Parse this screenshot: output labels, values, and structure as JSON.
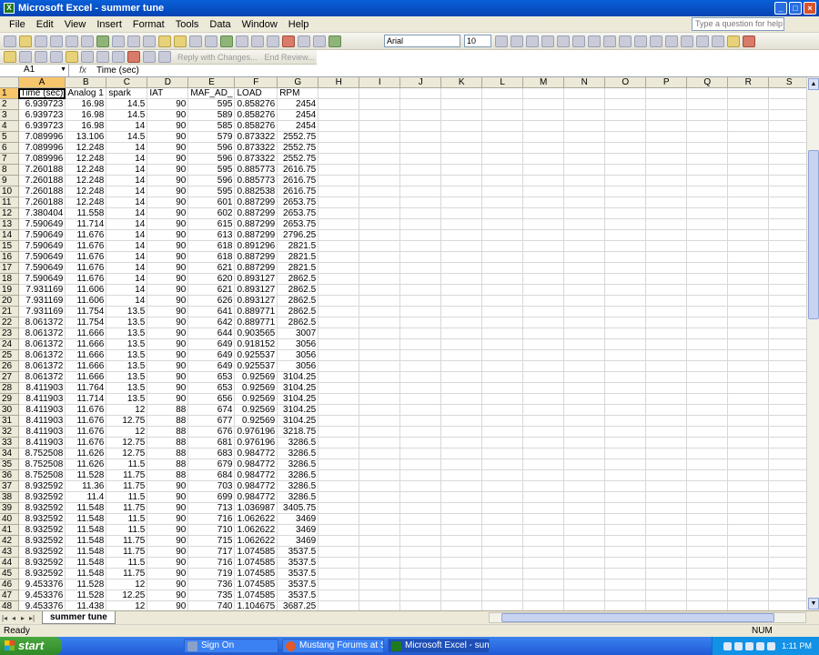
{
  "window": {
    "title": "Microsoft Excel - summer tune"
  },
  "menu": [
    "File",
    "Edit",
    "View",
    "Insert",
    "Format",
    "Tools",
    "Data",
    "Window",
    "Help"
  ],
  "help_placeholder": "Type a question for help",
  "formatting": {
    "font": "Arial",
    "size": "10"
  },
  "review_toolbar": {
    "reply_label": "Reply with Changes...",
    "end_label": "End Review..."
  },
  "formula_bar": {
    "cell_ref": "A1",
    "fx": "fx",
    "content": "Time (sec)"
  },
  "columns": [
    "A",
    "B",
    "C",
    "D",
    "E",
    "F",
    "G",
    "H",
    "I",
    "J",
    "K",
    "L",
    "M",
    "N",
    "O",
    "P",
    "Q",
    "R",
    "S"
  ],
  "headers": [
    "Time (sec)",
    "Analog 1",
    "spark",
    "IAT",
    "MAF_AD_",
    "LOAD",
    "RPM"
  ],
  "rows": [
    [
      "6.939723",
      "16.98",
      "14.5",
      "90",
      "595",
      "0.858276",
      "2454"
    ],
    [
      "6.939723",
      "16.98",
      "14.5",
      "90",
      "589",
      "0.858276",
      "2454"
    ],
    [
      "6.939723",
      "16.98",
      "14",
      "90",
      "585",
      "0.858276",
      "2454"
    ],
    [
      "7.089996",
      "13.106",
      "14.5",
      "90",
      "579",
      "0.873322",
      "2552.75"
    ],
    [
      "7.089996",
      "12.248",
      "14",
      "90",
      "596",
      "0.873322",
      "2552.75"
    ],
    [
      "7.089996",
      "12.248",
      "14",
      "90",
      "596",
      "0.873322",
      "2552.75"
    ],
    [
      "7.260188",
      "12.248",
      "14",
      "90",
      "595",
      "0.885773",
      "2616.75"
    ],
    [
      "7.260188",
      "12.248",
      "14",
      "90",
      "596",
      "0.885773",
      "2616.75"
    ],
    [
      "7.260188",
      "12.248",
      "14",
      "90",
      "595",
      "0.882538",
      "2616.75"
    ],
    [
      "7.260188",
      "12.248",
      "14",
      "90",
      "601",
      "0.887299",
      "2653.75"
    ],
    [
      "7.380404",
      "11.558",
      "14",
      "90",
      "602",
      "0.887299",
      "2653.75"
    ],
    [
      "7.590649",
      "11.714",
      "14",
      "90",
      "615",
      "0.887299",
      "2653.75"
    ],
    [
      "7.590649",
      "11.676",
      "14",
      "90",
      "613",
      "0.887299",
      "2796.25"
    ],
    [
      "7.590649",
      "11.676",
      "14",
      "90",
      "618",
      "0.891296",
      "2821.5"
    ],
    [
      "7.590649",
      "11.676",
      "14",
      "90",
      "618",
      "0.887299",
      "2821.5"
    ],
    [
      "7.590649",
      "11.676",
      "14",
      "90",
      "621",
      "0.887299",
      "2821.5"
    ],
    [
      "7.590649",
      "11.676",
      "14",
      "90",
      "620",
      "0.893127",
      "2862.5"
    ],
    [
      "7.931169",
      "11.606",
      "14",
      "90",
      "621",
      "0.893127",
      "2862.5"
    ],
    [
      "7.931169",
      "11.606",
      "14",
      "90",
      "626",
      "0.893127",
      "2862.5"
    ],
    [
      "7.931169",
      "11.754",
      "13.5",
      "90",
      "641",
      "0.889771",
      "2862.5"
    ],
    [
      "8.061372",
      "11.754",
      "13.5",
      "90",
      "642",
      "0.889771",
      "2862.5"
    ],
    [
      "8.061372",
      "11.666",
      "13.5",
      "90",
      "644",
      "0.903565",
      "3007"
    ],
    [
      "8.061372",
      "11.666",
      "13.5",
      "90",
      "649",
      "0.918152",
      "3056"
    ],
    [
      "8.061372",
      "11.666",
      "13.5",
      "90",
      "649",
      "0.925537",
      "3056"
    ],
    [
      "8.061372",
      "11.666",
      "13.5",
      "90",
      "649",
      "0.925537",
      "3056"
    ],
    [
      "8.061372",
      "11.666",
      "13.5",
      "90",
      "653",
      "0.92569",
      "3104.25"
    ],
    [
      "8.411903",
      "11.764",
      "13.5",
      "90",
      "653",
      "0.92569",
      "3104.25"
    ],
    [
      "8.411903",
      "11.714",
      "13.5",
      "90",
      "656",
      "0.92569",
      "3104.25"
    ],
    [
      "8.411903",
      "11.676",
      "12",
      "88",
      "674",
      "0.92569",
      "3104.25"
    ],
    [
      "8.411903",
      "11.676",
      "12.75",
      "88",
      "677",
      "0.92569",
      "3104.25"
    ],
    [
      "8.411903",
      "11.676",
      "12",
      "88",
      "676",
      "0.976196",
      "3218.75"
    ],
    [
      "8.411903",
      "11.676",
      "12.75",
      "88",
      "681",
      "0.976196",
      "3286.5"
    ],
    [
      "8.752508",
      "11.626",
      "12.75",
      "88",
      "683",
      "0.984772",
      "3286.5"
    ],
    [
      "8.752508",
      "11.626",
      "11.5",
      "88",
      "679",
      "0.984772",
      "3286.5"
    ],
    [
      "8.752508",
      "11.528",
      "11.75",
      "88",
      "684",
      "0.984772",
      "3286.5"
    ],
    [
      "8.932592",
      "11.36",
      "11.75",
      "90",
      "703",
      "0.984772",
      "3286.5"
    ],
    [
      "8.932592",
      "11.4",
      "11.5",
      "90",
      "699",
      "0.984772",
      "3286.5"
    ],
    [
      "8.932592",
      "11.548",
      "11.75",
      "90",
      "713",
      "1.036987",
      "3405.75"
    ],
    [
      "8.932592",
      "11.548",
      "11.5",
      "90",
      "716",
      "1.062622",
      "3469"
    ],
    [
      "8.932592",
      "11.548",
      "11.5",
      "90",
      "710",
      "1.062622",
      "3469"
    ],
    [
      "8.932592",
      "11.548",
      "11.75",
      "90",
      "715",
      "1.062622",
      "3469"
    ],
    [
      "8.932592",
      "11.548",
      "11.75",
      "90",
      "717",
      "1.074585",
      "3537.5"
    ],
    [
      "8.932592",
      "11.548",
      "11.5",
      "90",
      "716",
      "1.074585",
      "3537.5"
    ],
    [
      "8.932592",
      "11.548",
      "11.75",
      "90",
      "719",
      "1.074585",
      "3537.5"
    ],
    [
      "9.453376",
      "11.528",
      "12",
      "90",
      "736",
      "1.074585",
      "3537.5"
    ],
    [
      "9.453376",
      "11.528",
      "12.25",
      "90",
      "735",
      "1.074585",
      "3537.5"
    ],
    [
      "9.453376",
      "11.438",
      "12",
      "90",
      "740",
      "1.104675",
      "3687.25"
    ]
  ],
  "sheet_tab": "summer tune",
  "status": {
    "left": "Ready",
    "num": "NUM"
  },
  "taskbar": {
    "start": "start",
    "tasks": [
      "Sign On",
      "Mustang Forums at S...",
      "Microsoft Excel - sum..."
    ],
    "clock": "1:11 PM"
  },
  "colors": {
    "title_bg": "#0a5fd8",
    "active_cell_header": "#f7c66b",
    "taskbar": "#1f5ad6",
    "start_green": "#4aa83f"
  }
}
